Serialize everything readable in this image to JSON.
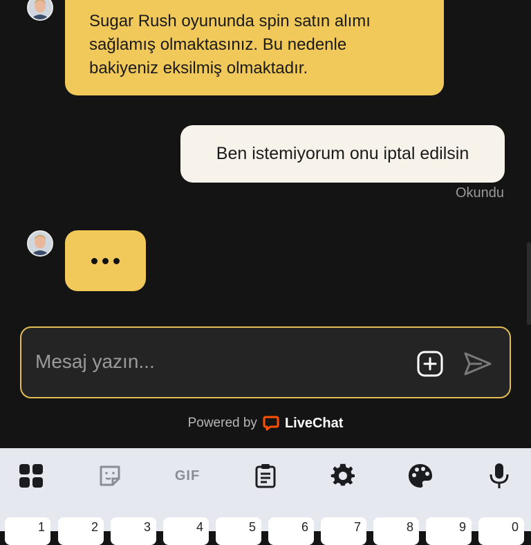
{
  "chat": {
    "messages": [
      {
        "from": "agent",
        "text": "Sugar Rush oyununda spin satın alımı sağlamış olmaktasınız. Bu nedenle bakiyeniz eksilmiş olmaktadır."
      },
      {
        "from": "user",
        "text": "Ben istemiyorum onu iptal edilsin",
        "status": "Okundu"
      }
    ],
    "typing": {
      "dots": "•••"
    }
  },
  "composer": {
    "placeholder": "Mesaj yazın...",
    "icons": [
      "add-attachment-icon",
      "send-icon"
    ]
  },
  "footer": {
    "powered_by": "Powered by",
    "brand": "LiveChat",
    "brand_color": "#ff5100"
  },
  "colors": {
    "background": "#141414",
    "agent_bubble": "#f1c85a",
    "user_bubble": "#f7f3ea",
    "accent_border": "#e4bd55"
  },
  "keyboard": {
    "toolbar": [
      "apps-icon",
      "sticker-icon",
      "gif-icon",
      "clipboard-icon",
      "settings-icon",
      "palette-icon",
      "microphone-icon"
    ],
    "gif_label": "GIF",
    "number_keys": [
      "1",
      "2",
      "3",
      "4",
      "5",
      "6",
      "7",
      "8",
      "9",
      "0"
    ]
  }
}
